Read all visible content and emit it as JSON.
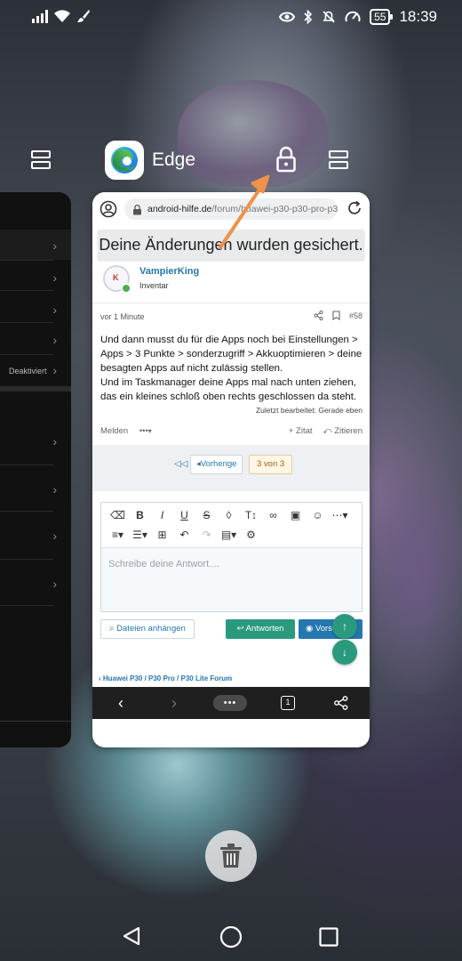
{
  "status_bar": {
    "time": "18:39",
    "battery": "55",
    "icons": [
      "signal-icon",
      "wifi-icon",
      "brush-icon",
      "eye-icon",
      "bluetooth-icon",
      "mute-bell-icon",
      "speedometer-icon"
    ]
  },
  "recents": {
    "app_name": "Edge",
    "left_card_label": "Deaktiviert"
  },
  "browser": {
    "url_domain": "android-hilfe.de",
    "url_path": "/forum/huawei-p30-p30-pro-p3",
    "toast": "Deine Änderungen wurden gesichert.",
    "toolbar": {
      "more_label": "•••",
      "tab_count": "1"
    }
  },
  "post": {
    "username": "VampierKing",
    "role": "Inventar",
    "time": "vor 1 Minute",
    "number": "#58",
    "text": "Und dann musst du für die Apps noch bei Einstellungen > Apps > 3 Punkte > sonderzugriff > Akkuoptimieren > deine besagten Apps auf nicht zulässig stellen.\nUnd im Taskmanager deine Apps mal nach unten ziehen, das ein kleines schloß oben rechts geschlossen da steht.",
    "edited": "Zuletzt bearbeitet: Gerade eben",
    "report_label": "Melden",
    "more_label": "•••",
    "quote_label": "Zitat",
    "cite_label": "Zitieren"
  },
  "pager": {
    "prev_label": "Vorherige",
    "count_label": "3 von 3"
  },
  "editor": {
    "placeholder": "Schreibe deine Antwort....",
    "attach_label": "Dateien anhängen",
    "reply_label": "Antworten",
    "preview_label": "Vorschau"
  },
  "breadcrumb": "Huawei P30 / P30 Pro / P30 Lite Forum",
  "colors": {
    "link_blue": "#2577b1",
    "reply_green": "#2a9a7e",
    "annotation_orange": "#f0914a"
  }
}
